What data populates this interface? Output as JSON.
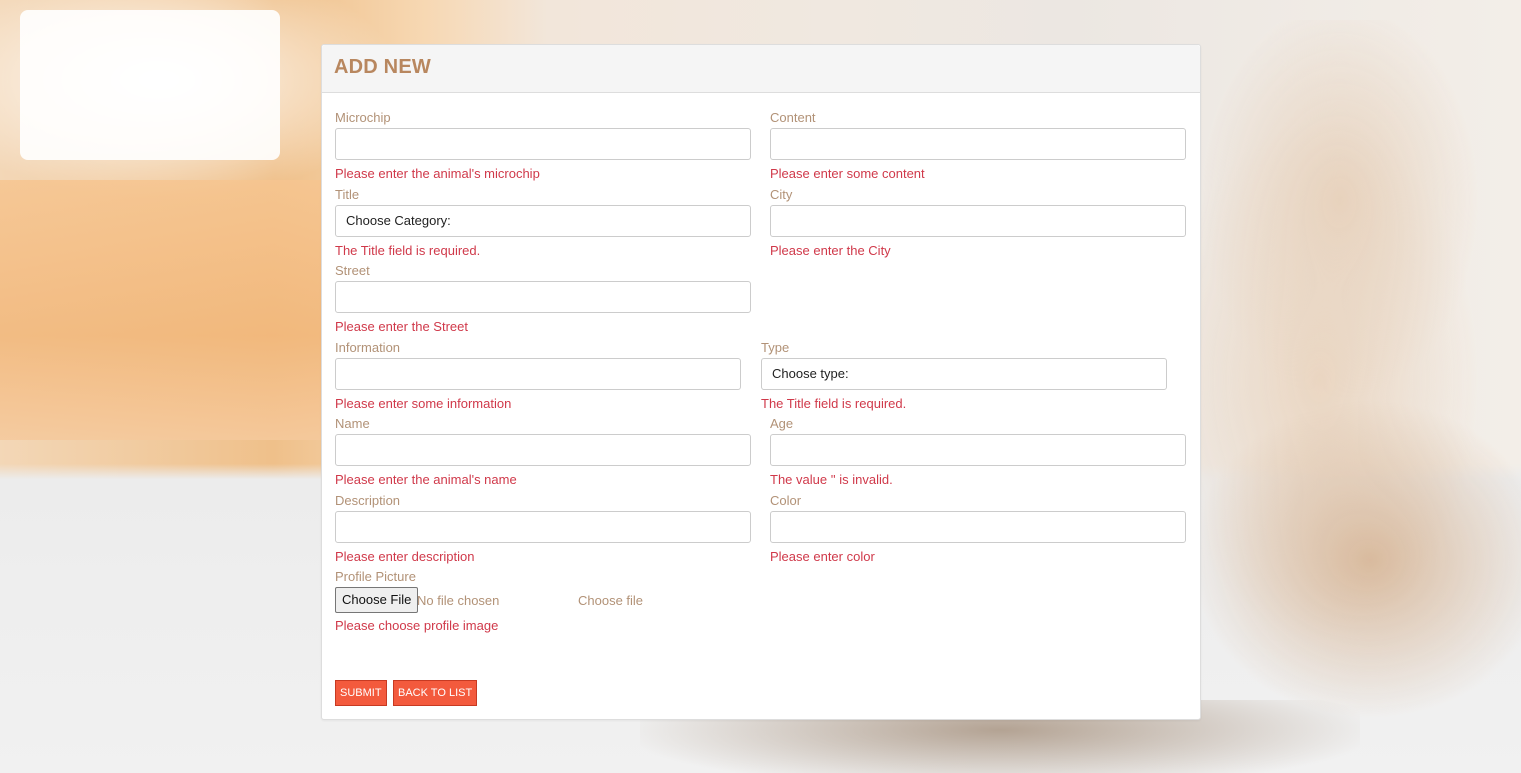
{
  "form": {
    "title": "ADD NEW",
    "fields": {
      "microchip": {
        "label": "Microchip",
        "value": "",
        "error": "Please enter the animal's microchip"
      },
      "content": {
        "label": "Content",
        "value": "",
        "error": "Please enter some content"
      },
      "title": {
        "label": "Title",
        "selected": "Choose Category:",
        "error": "The Title field is required."
      },
      "city": {
        "label": "City",
        "value": "",
        "error": "Please enter the City"
      },
      "street": {
        "label": "Street",
        "value": "",
        "error": "Please enter the Street"
      },
      "information": {
        "label": "Information",
        "value": "",
        "error": "Please enter some information"
      },
      "type": {
        "label": "Type",
        "selected": "Choose type:",
        "error": "The Title field is required."
      },
      "name": {
        "label": "Name",
        "value": "",
        "error": "Please enter the animal's name"
      },
      "age": {
        "label": "Age",
        "value": "",
        "error": "The value '' is invalid."
      },
      "description": {
        "label": "Description",
        "value": "",
        "error": "Please enter description"
      },
      "color": {
        "label": "Color",
        "value": "",
        "error": "Please enter color"
      },
      "profile_picture": {
        "label": "Profile Picture",
        "button": "Choose File",
        "status": "No file chosen",
        "choose_label": "Choose file",
        "error": "Please choose profile image"
      }
    },
    "buttons": {
      "submit": "SUBMIT",
      "back": "BACK TO LIST"
    }
  },
  "colors": {
    "title": "#b8875f",
    "label": "#b29277",
    "error": "#d0394a",
    "button": "#f35a3d"
  }
}
